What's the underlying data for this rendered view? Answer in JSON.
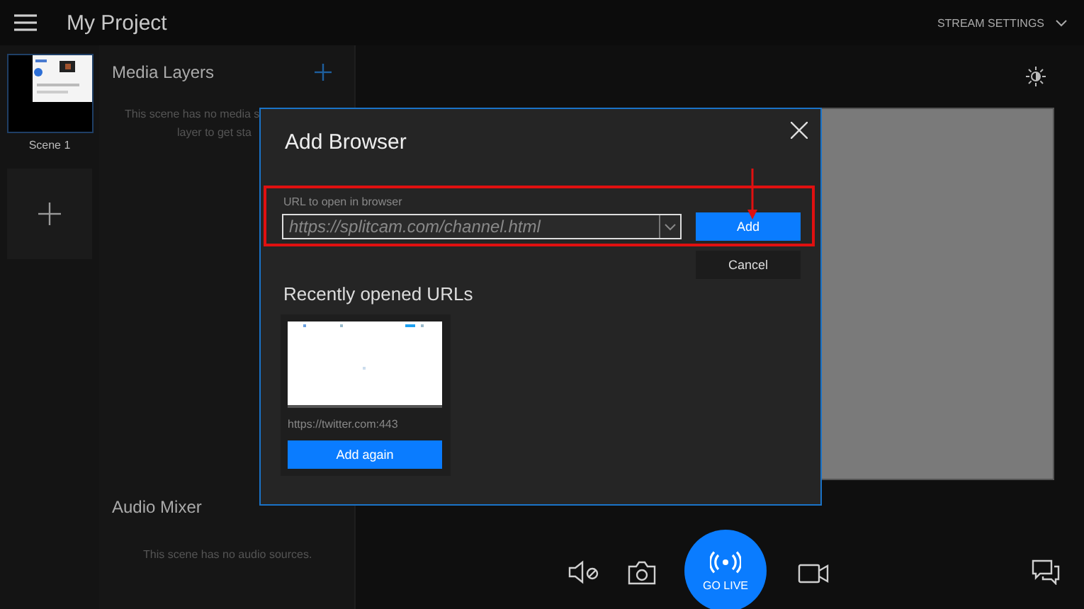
{
  "topbar": {
    "title": "My Project",
    "stream_settings": "STREAM SETTINGS"
  },
  "scenes": [
    {
      "label": "Scene 1",
      "selected": true
    }
  ],
  "media_layers": {
    "title": "Media Layers",
    "empty_lines": [
      "This scene has no media s",
      "layer to get sta"
    ]
  },
  "audio_mixer": {
    "title": "Audio Mixer",
    "empty_text": "This scene has no audio sources."
  },
  "controls": {
    "go_live": "GO LIVE"
  },
  "dialog": {
    "title": "Add Browser",
    "url_label": "URL to open in browser",
    "url_placeholder": "https://splitcam.com/channel.html",
    "add_button": "Add",
    "cancel_button": "Cancel",
    "recent_title": "Recently opened URLs",
    "recent": [
      {
        "url": "https://twitter.com:443",
        "button": "Add again"
      }
    ]
  }
}
